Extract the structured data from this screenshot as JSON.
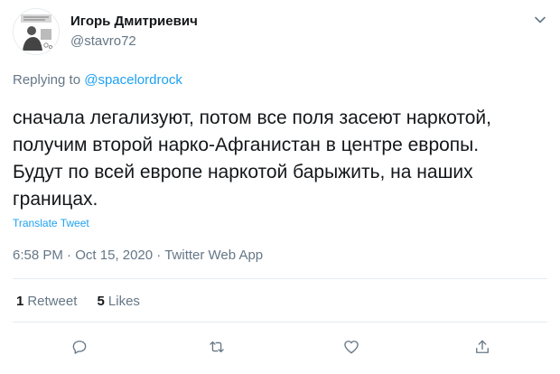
{
  "user": {
    "name": "Игорь Дмитриевич",
    "handle": "@stavro72"
  },
  "replying": {
    "prefix": "Replying to",
    "mention": "@spacelordrock"
  },
  "tweet": {
    "text": "сначала легализуют, потом все поля засеют наркотой, получим второй нарко-Афганистан в центре европы. Будут по всей европе наркотой барыжить, на наших границах.",
    "translate_label": "Translate Tweet",
    "time": "6:58 PM",
    "date": "Oct 15, 2020",
    "source": "Twitter Web App",
    "meta_separator": " · "
  },
  "stats": {
    "retweets_count": "1",
    "retweets_label": "Retweet",
    "likes_count": "5",
    "likes_label": "Likes"
  },
  "icons": {
    "more": "chevron-down-icon",
    "reply": "reply-icon",
    "retweet": "retweet-icon",
    "like": "like-icon",
    "share": "share-icon"
  },
  "colors": {
    "text": "#14171a",
    "secondary": "#657786",
    "link": "#1da1f2",
    "divider": "#e6ecf0"
  }
}
